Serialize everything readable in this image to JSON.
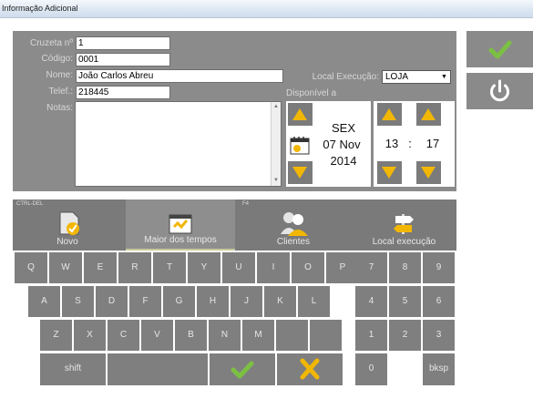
{
  "window": {
    "title": "Informação Adicional"
  },
  "form": {
    "cruzeta_label": "Cruzeta nº",
    "cruzeta_value": "1",
    "codigo_label": "Código:",
    "codigo_value": "0001",
    "nome_label": "Nome:",
    "nome_value": "João Carlos Abreu",
    "telef_label": "Telef.:",
    "telef_value": "218445",
    "notas_label": "Notas:",
    "local_label": "Local Execução:",
    "local_value": "LOJA",
    "disponivel_label": "Disponível a"
  },
  "date": {
    "weekday": "SEX",
    "day_month": "07 Nov",
    "year": "2014"
  },
  "time": {
    "hour": "13",
    "separator": ":",
    "minute": "17"
  },
  "tabs": [
    {
      "fkey": "CTRL-DEL",
      "label": "Novo"
    },
    {
      "fkey": "",
      "label": "Maior dos tempos"
    },
    {
      "fkey": "F4",
      "label": "Clientes"
    },
    {
      "fkey": "",
      "label": "Local execução"
    }
  ],
  "keyboard": {
    "row1": [
      "Q",
      "W",
      "E",
      "R",
      "T",
      "Y",
      "U",
      "I",
      "O",
      "P"
    ],
    "row2": [
      "A",
      "S",
      "D",
      "F",
      "G",
      "H",
      "J",
      "K",
      "L"
    ],
    "row3": [
      "Z",
      "X",
      "C",
      "V",
      "B",
      "N",
      "M"
    ],
    "numpad": [
      "7",
      "8",
      "9",
      "4",
      "5",
      "6",
      "1",
      "2",
      "3",
      "0"
    ],
    "shift_label": "shift",
    "bksp_label": "bksp"
  },
  "colors": {
    "confirm": "#7cc043",
    "cancel": "#f2b705",
    "panel": "#8b8b8b"
  }
}
